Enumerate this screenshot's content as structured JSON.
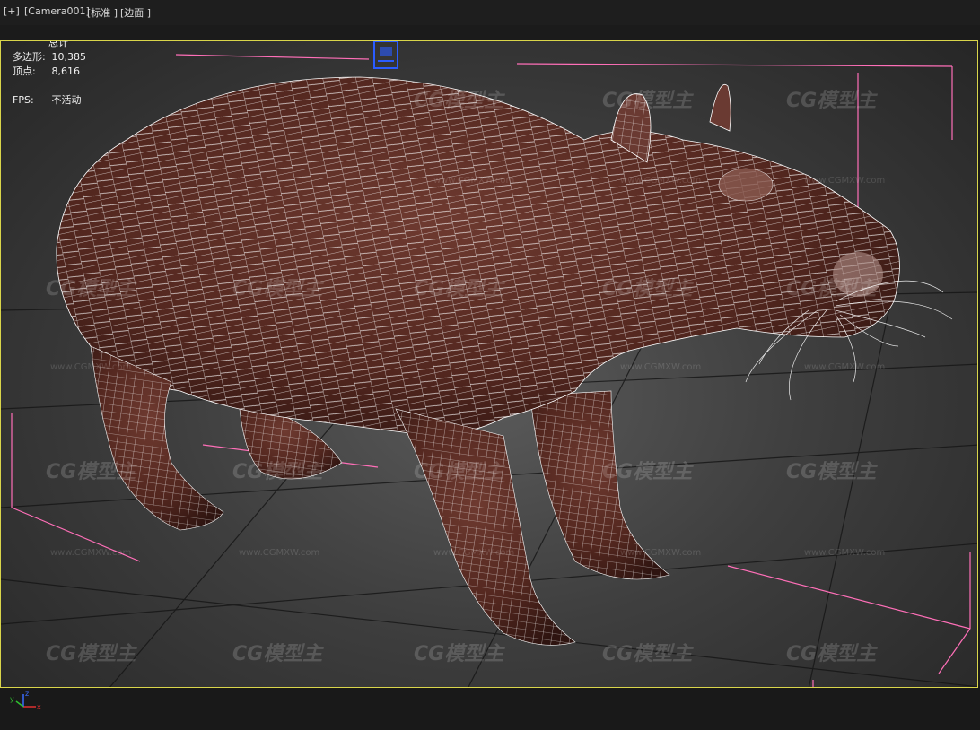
{
  "viewport_header": {
    "plus_menu": "[+]",
    "camera_menu": "[Camera001]",
    "shading_menu": "[标准 ]",
    "edge_menu": "[边面 ]"
  },
  "stats": {
    "total_label": "总计",
    "polygons_label": "多边形:",
    "polygons_value": "10,385",
    "vertices_label": "顶点:",
    "vertices_value": "8,616",
    "fps_label": "FPS:",
    "fps_value": "不活动"
  },
  "watermark": {
    "logo_text": "CG模型主",
    "url_text": "www.CGMXW.com"
  },
  "axis_gizmo": {
    "x_label": "x",
    "y_label": "y",
    "z_label": "z"
  },
  "colors": {
    "viewport_border": "#d9d54a",
    "selection_bracket": "#ff6fb8",
    "mesh_fill": "#5a2c24",
    "wire": "#ffffff",
    "camera_icon": "#2a5cff"
  },
  "icons": [
    "camera-icon",
    "axis-gizmo-icon"
  ]
}
